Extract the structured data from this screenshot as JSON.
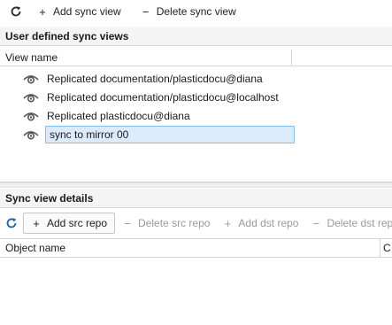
{
  "top_toolbar": {
    "refresh_icon": "refresh-icon",
    "add_label": "Add sync view",
    "delete_label": "Delete sync view"
  },
  "sync_views": {
    "section_title": "User defined sync views",
    "column_header": "View name",
    "items": [
      {
        "label": "Replicated documentation/plasticdocu@diana",
        "icon": "eye-icon"
      },
      {
        "label": "Replicated documentation/plasticdocu@localhost",
        "icon": "eye-icon"
      },
      {
        "label": "Replicated plasticdocu@diana",
        "icon": "eye-icon"
      },
      {
        "label": "sync to mirror 00",
        "icon": "eye-icon",
        "editing": true
      }
    ]
  },
  "details": {
    "section_title": "Sync view details",
    "toolbar": {
      "refresh_icon": "refresh-icon",
      "add_src_label": "Add src repo",
      "delete_src_label": "Delete src repo",
      "add_dst_label": "Add dst repo",
      "delete_dst_label": "Delete dst rep"
    },
    "columns": [
      "Object name",
      "C"
    ]
  },
  "colors": {
    "accent_blue": "#1f5fa8",
    "selection_bg": "#dcebfb",
    "selection_border": "#8cbde9",
    "disabled_text": "#9a9a9a"
  }
}
